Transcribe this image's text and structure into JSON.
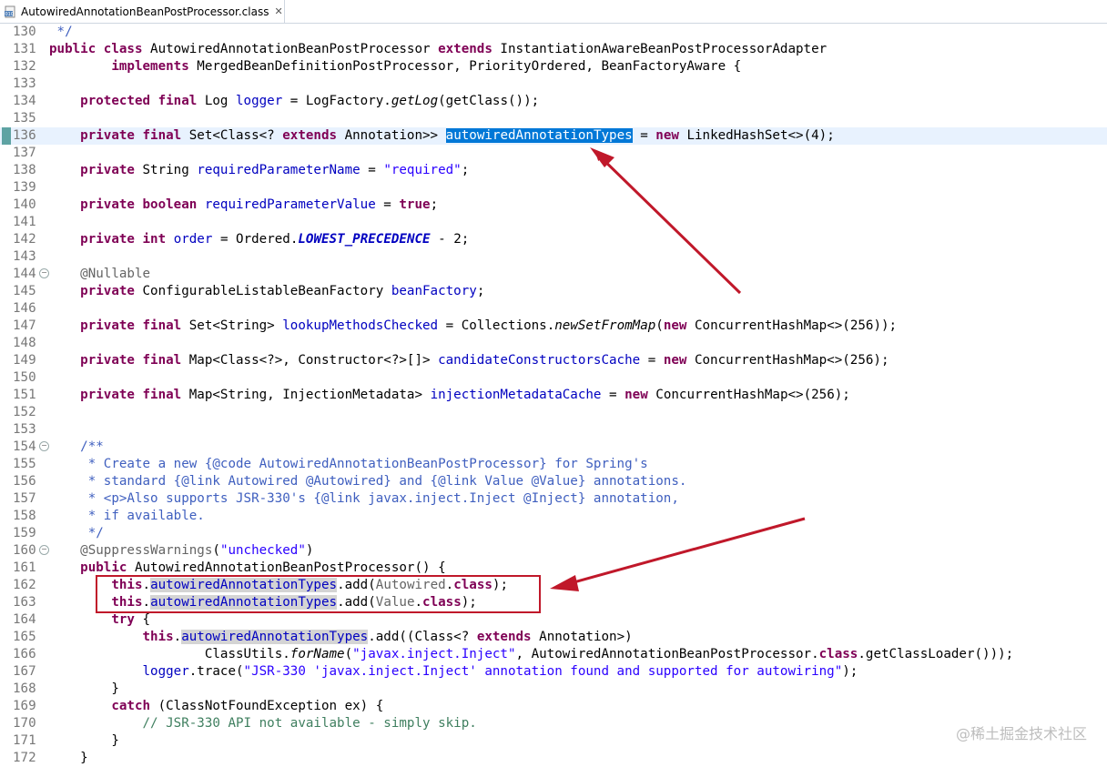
{
  "tab": {
    "title": "AutowiredAnnotationBeanPostProcessor.class",
    "close_glyph": "✕",
    "icon": "class-file-icon"
  },
  "watermark": "@稀土掘金技术社区",
  "colors": {
    "keyword": "#7f0055",
    "field": "#0000c0",
    "string": "#2a00ff",
    "comment": "#3f7f5f",
    "javadoc": "#3f5fbf",
    "selection": "#0078d7",
    "annotation_arrow": "#c0182a"
  },
  "lines": [
    {
      "n": "130",
      "tokens": [
        {
          "t": " */",
          "c": "jd"
        }
      ]
    },
    {
      "n": "131",
      "tokens": [
        {
          "t": "public class",
          "c": "kw"
        },
        {
          "t": " AutowiredAnnotationBeanPostProcessor "
        },
        {
          "t": "extends",
          "c": "kw"
        },
        {
          "t": " InstantiationAwareBeanPostProcessorAdapter"
        }
      ]
    },
    {
      "n": "132",
      "tokens": [
        {
          "t": "        "
        },
        {
          "t": "implements",
          "c": "kw"
        },
        {
          "t": " MergedBeanDefinitionPostProcessor, PriorityOrdered, BeanFactoryAware {"
        }
      ]
    },
    {
      "n": "133",
      "tokens": []
    },
    {
      "n": "134",
      "tokens": [
        {
          "t": "    "
        },
        {
          "t": "protected final",
          "c": "kw"
        },
        {
          "t": " Log "
        },
        {
          "t": "logger",
          "c": "fld"
        },
        {
          "t": " = LogFactory."
        },
        {
          "t": "getLog",
          "c": "it"
        },
        {
          "t": "(getClass());"
        }
      ]
    },
    {
      "n": "135",
      "tokens": []
    },
    {
      "n": "136",
      "current": true,
      "tokens": [
        {
          "t": "    "
        },
        {
          "t": "private final",
          "c": "kw"
        },
        {
          "t": " Set<Class<? "
        },
        {
          "t": "extends",
          "c": "kw"
        },
        {
          "t": " Annotation>> "
        },
        {
          "t": "autowiredAnnotationTypes",
          "c": "sel"
        },
        {
          "t": " = "
        },
        {
          "t": "new",
          "c": "kw"
        },
        {
          "t": " LinkedHashSet<>(4);"
        }
      ]
    },
    {
      "n": "137",
      "tokens": []
    },
    {
      "n": "138",
      "tokens": [
        {
          "t": "    "
        },
        {
          "t": "private",
          "c": "kw"
        },
        {
          "t": " String "
        },
        {
          "t": "requiredParameterName",
          "c": "fld"
        },
        {
          "t": " = "
        },
        {
          "t": "\"required\"",
          "c": "str"
        },
        {
          "t": ";"
        }
      ]
    },
    {
      "n": "139",
      "tokens": []
    },
    {
      "n": "140",
      "tokens": [
        {
          "t": "    "
        },
        {
          "t": "private boolean",
          "c": "kw"
        },
        {
          "t": " "
        },
        {
          "t": "requiredParameterValue",
          "c": "fld"
        },
        {
          "t": " = "
        },
        {
          "t": "true",
          "c": "kw"
        },
        {
          "t": ";"
        }
      ]
    },
    {
      "n": "141",
      "tokens": []
    },
    {
      "n": "142",
      "tokens": [
        {
          "t": "    "
        },
        {
          "t": "private int",
          "c": "kw"
        },
        {
          "t": " "
        },
        {
          "t": "order",
          "c": "fld"
        },
        {
          "t": " = Ordered."
        },
        {
          "t": "LOWEST_PRECEDENCE",
          "c": "const"
        },
        {
          "t": " - 2;"
        }
      ]
    },
    {
      "n": "143",
      "tokens": []
    },
    {
      "n": "144",
      "fold": true,
      "tokens": [
        {
          "t": "    "
        },
        {
          "t": "@Nullable",
          "c": "ann"
        }
      ]
    },
    {
      "n": "145",
      "tokens": [
        {
          "t": "    "
        },
        {
          "t": "private",
          "c": "kw"
        },
        {
          "t": " ConfigurableListableBeanFactory "
        },
        {
          "t": "beanFactory",
          "c": "fld"
        },
        {
          "t": ";"
        }
      ]
    },
    {
      "n": "146",
      "tokens": []
    },
    {
      "n": "147",
      "tokens": [
        {
          "t": "    "
        },
        {
          "t": "private final",
          "c": "kw"
        },
        {
          "t": " Set<String> "
        },
        {
          "t": "lookupMethodsChecked",
          "c": "fld"
        },
        {
          "t": " = Collections."
        },
        {
          "t": "newSetFromMap",
          "c": "it"
        },
        {
          "t": "("
        },
        {
          "t": "new",
          "c": "kw"
        },
        {
          "t": " ConcurrentHashMap<>(256));"
        }
      ]
    },
    {
      "n": "148",
      "tokens": []
    },
    {
      "n": "149",
      "tokens": [
        {
          "t": "    "
        },
        {
          "t": "private final",
          "c": "kw"
        },
        {
          "t": " Map<Class<?>, Constructor<?>[]> "
        },
        {
          "t": "candidateConstructorsCache",
          "c": "fld"
        },
        {
          "t": " = "
        },
        {
          "t": "new",
          "c": "kw"
        },
        {
          "t": " ConcurrentHashMap<>(256);"
        }
      ]
    },
    {
      "n": "150",
      "tokens": []
    },
    {
      "n": "151",
      "tokens": [
        {
          "t": "    "
        },
        {
          "t": "private final",
          "c": "kw"
        },
        {
          "t": " Map<String, InjectionMetadata> "
        },
        {
          "t": "injectionMetadataCache",
          "c": "fld"
        },
        {
          "t": " = "
        },
        {
          "t": "new",
          "c": "kw"
        },
        {
          "t": " ConcurrentHashMap<>(256);"
        }
      ]
    },
    {
      "n": "152",
      "tokens": []
    },
    {
      "n": "153",
      "tokens": []
    },
    {
      "n": "154",
      "fold": true,
      "tokens": [
        {
          "t": "    "
        },
        {
          "t": "/**",
          "c": "jd"
        }
      ]
    },
    {
      "n": "155",
      "tokens": [
        {
          "t": "     * Create a new {@code AutowiredAnnotationBeanPostProcessor} for Spring's",
          "c": "jd"
        }
      ]
    },
    {
      "n": "156",
      "tokens": [
        {
          "t": "     * standard {@link Autowired @Autowired} and {@link Value @Value} annotations.",
          "c": "jd"
        }
      ]
    },
    {
      "n": "157",
      "tokens": [
        {
          "t": "     * <p>Also supports JSR-330's {@link javax.inject.Inject @Inject} annotation,",
          "c": "jd"
        }
      ]
    },
    {
      "n": "158",
      "tokens": [
        {
          "t": "     * if available.",
          "c": "jd"
        }
      ]
    },
    {
      "n": "159",
      "tokens": [
        {
          "t": "     */",
          "c": "jd"
        }
      ]
    },
    {
      "n": "160",
      "fold": true,
      "tokens": [
        {
          "t": "    "
        },
        {
          "t": "@SuppressWarnings",
          "c": "ann"
        },
        {
          "t": "("
        },
        {
          "t": "\"unchecked\"",
          "c": "str"
        },
        {
          "t": ")"
        }
      ]
    },
    {
      "n": "161",
      "tokens": [
        {
          "t": "    "
        },
        {
          "t": "public",
          "c": "kw"
        },
        {
          "t": " AutowiredAnnotationBeanPostProcessor() {"
        }
      ]
    },
    {
      "n": "162",
      "tokens": [
        {
          "t": "        "
        },
        {
          "t": "this",
          "c": "kw"
        },
        {
          "t": "."
        },
        {
          "t": "autowiredAnnotationTypes",
          "c": "fld occ"
        },
        {
          "t": ".add("
        },
        {
          "t": "Autowired",
          "c": "ann"
        },
        {
          "t": "."
        },
        {
          "t": "class",
          "c": "kw"
        },
        {
          "t": ");"
        }
      ]
    },
    {
      "n": "163",
      "tokens": [
        {
          "t": "        "
        },
        {
          "t": "this",
          "c": "kw"
        },
        {
          "t": "."
        },
        {
          "t": "autowiredAnnotationTypes",
          "c": "fld occ"
        },
        {
          "t": ".add("
        },
        {
          "t": "Value",
          "c": "ann"
        },
        {
          "t": "."
        },
        {
          "t": "class",
          "c": "kw"
        },
        {
          "t": ");"
        }
      ]
    },
    {
      "n": "164",
      "tokens": [
        {
          "t": "        "
        },
        {
          "t": "try",
          "c": "kw"
        },
        {
          "t": " {"
        }
      ]
    },
    {
      "n": "165",
      "tokens": [
        {
          "t": "            "
        },
        {
          "t": "this",
          "c": "kw"
        },
        {
          "t": "."
        },
        {
          "t": "autowiredAnnotationTypes",
          "c": "fld occ"
        },
        {
          "t": ".add((Class<? "
        },
        {
          "t": "extends",
          "c": "kw"
        },
        {
          "t": " Annotation>)"
        }
      ]
    },
    {
      "n": "166",
      "tokens": [
        {
          "t": "                    ClassUtils."
        },
        {
          "t": "forName",
          "c": "it"
        },
        {
          "t": "("
        },
        {
          "t": "\"javax.inject.Inject\"",
          "c": "str"
        },
        {
          "t": ", AutowiredAnnotationBeanPostProcessor."
        },
        {
          "t": "class",
          "c": "kw"
        },
        {
          "t": ".getClassLoader()));"
        }
      ]
    },
    {
      "n": "167",
      "tokens": [
        {
          "t": "            "
        },
        {
          "t": "logger",
          "c": "fld"
        },
        {
          "t": ".trace("
        },
        {
          "t": "\"JSR-330 'javax.inject.Inject' annotation found and supported for autowiring\"",
          "c": "str"
        },
        {
          "t": ");"
        }
      ]
    },
    {
      "n": "168",
      "tokens": [
        {
          "t": "        }"
        }
      ]
    },
    {
      "n": "169",
      "tokens": [
        {
          "t": "        "
        },
        {
          "t": "catch",
          "c": "kw"
        },
        {
          "t": " (ClassNotFoundException ex) {"
        }
      ]
    },
    {
      "n": "170",
      "tokens": [
        {
          "t": "            "
        },
        {
          "t": "// JSR-330 API not available - simply skip.",
          "c": "cm"
        }
      ]
    },
    {
      "n": "171",
      "tokens": [
        {
          "t": "        }"
        }
      ]
    },
    {
      "n": "172",
      "tokens": [
        {
          "t": "    }"
        }
      ]
    }
  ]
}
